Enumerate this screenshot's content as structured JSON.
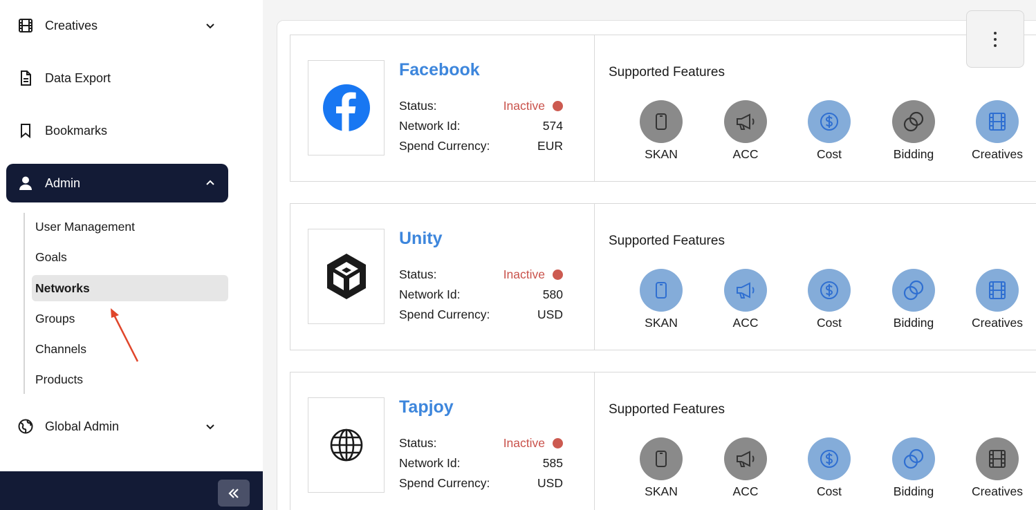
{
  "sidebar": {
    "items": [
      {
        "label": "Creatives",
        "icon": "film-icon"
      },
      {
        "label": "Data Export",
        "icon": "document-icon"
      },
      {
        "label": "Bookmarks",
        "icon": "bookmark-icon"
      },
      {
        "label": "Admin",
        "icon": "user-icon"
      },
      {
        "label": "Global Admin",
        "icon": "globe-icon"
      }
    ],
    "admin_sub": [
      "User Management",
      "Goals",
      "Networks",
      "Groups",
      "Channels",
      "Products"
    ],
    "selected_sub": "Networks"
  },
  "colors": {
    "accent": "#3d86dc",
    "sidebar_dark": "#131b36",
    "inactive": "#c9524b",
    "feature_on": "#84acd9",
    "feature_off": "#8a8a8a",
    "arrow": "#e0462b"
  },
  "features_title": "Supported Features",
  "feature_labels": [
    "SKAN",
    "ACC",
    "Cost",
    "Bidding",
    "Creatives"
  ],
  "info_labels": {
    "status": "Status:",
    "network_id": "Network Id:",
    "currency": "Spend Currency:"
  },
  "networks": [
    {
      "name": "Facebook",
      "status": "Inactive",
      "network_id": "574",
      "currency": "EUR",
      "logo": "facebook-logo",
      "features": [
        false,
        false,
        true,
        false,
        true
      ]
    },
    {
      "name": "Unity",
      "status": "Inactive",
      "network_id": "580",
      "currency": "USD",
      "logo": "unity-logo",
      "features": [
        true,
        true,
        true,
        true,
        true
      ]
    },
    {
      "name": "Tapjoy",
      "status": "Inactive",
      "network_id": "585",
      "currency": "USD",
      "logo": "globe-logo",
      "features": [
        false,
        false,
        true,
        true,
        false
      ]
    }
  ]
}
